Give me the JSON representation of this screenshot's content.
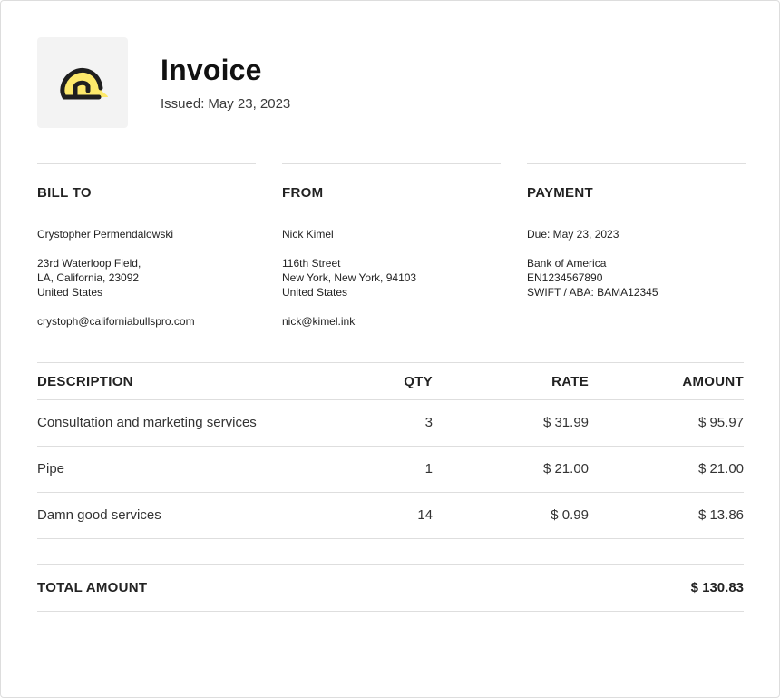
{
  "header": {
    "title": "Invoice",
    "issued_label": "Issued:",
    "issued_date": "May 23, 2023",
    "logo_icon": "bun-logo-icon",
    "logo_accent_color": "#FDE96B"
  },
  "bill_to": {
    "heading": "BILL TO",
    "name": "Crystopher Permendalowski",
    "address_line1": "23rd Waterloop Field,",
    "address_line2": "LA, California, 23092",
    "country": "United States",
    "email": "crystoph@californiabullspro.com"
  },
  "from": {
    "heading": "FROM",
    "name": "Nick Kimel",
    "address_line1": "116th Street",
    "address_line2": "New York, New York, 94103",
    "country": "United States",
    "email": "nick@kimel.ink"
  },
  "payment": {
    "heading": "PAYMENT",
    "due": "Due: May 23, 2023",
    "bank": "Bank of America",
    "account": "EN1234567890",
    "swift": "SWIFT / ABA: BAMA12345"
  },
  "table": {
    "headers": {
      "description": "DESCRIPTION",
      "qty": "QTY",
      "rate": "RATE",
      "amount": "AMOUNT"
    },
    "rows": [
      {
        "description": "Consultation and marketing services",
        "qty": "3",
        "rate": "$ 31.99",
        "amount": "$ 95.97"
      },
      {
        "description": "Pipe",
        "qty": "1",
        "rate": "$ 21.00",
        "amount": "$ 21.00"
      },
      {
        "description": "Damn good services",
        "qty": "14",
        "rate": "$ 0.99",
        "amount": "$ 13.86"
      }
    ]
  },
  "total": {
    "label": "TOTAL AMOUNT",
    "value": "$ 130.83"
  }
}
